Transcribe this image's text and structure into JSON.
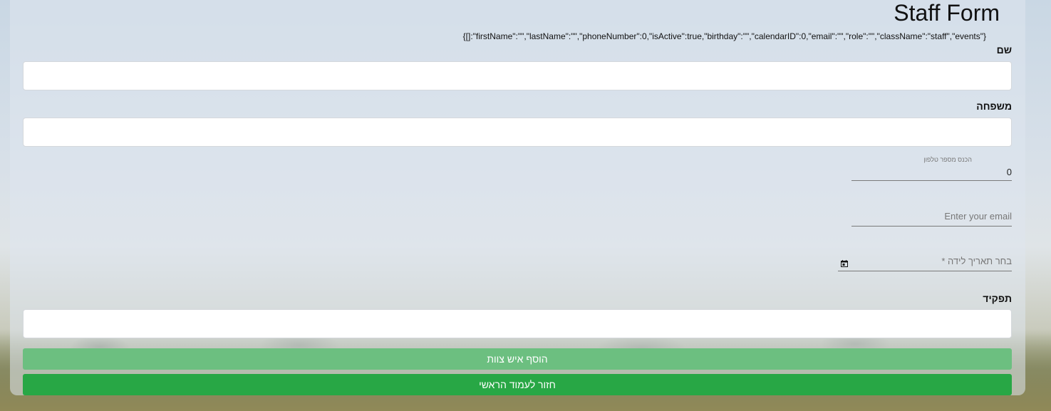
{
  "form": {
    "title": "Staff Form",
    "json_preview": "{[]:\"firstName\":\"\",\"lastName\":\"\",\"phoneNumber\":0,\"isActive\":true,\"birthday\":\"\",\"calendarID\":0,\"email\":\"\",\"role\":\"\",\"className\":\"staff\",\"events\"}",
    "first_name_label": "שם",
    "first_name_value": "",
    "last_name_label": "משפחה",
    "last_name_value": "",
    "phone_label": "הכנס מספר טלפון",
    "phone_value": "0",
    "email_placeholder": "Enter your email",
    "birthday_placeholder": "בחר תאריך לידה *",
    "role_label": "תפקיד",
    "role_value": "",
    "add_button_label": "הוסף איש צוות",
    "home_button_label": "חזור לעמוד הראשי"
  },
  "colors": {
    "add_button": "#6cbf80",
    "home_button": "#28a745"
  },
  "icons": {
    "birthday": "calendar-icon"
  }
}
